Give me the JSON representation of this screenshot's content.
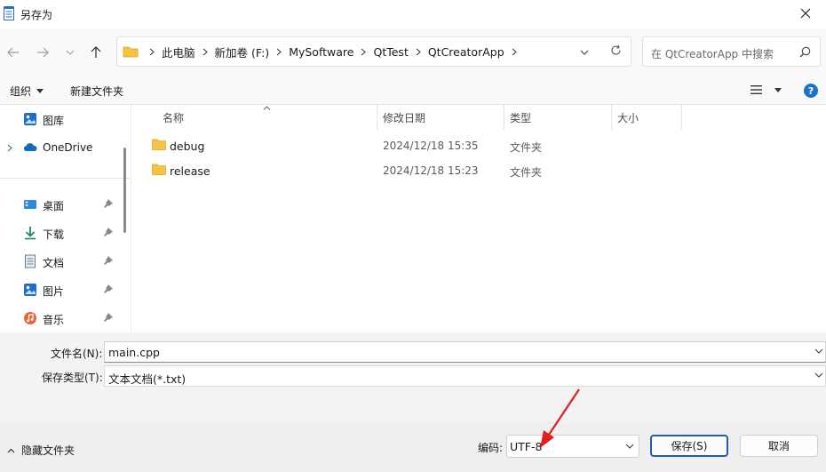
{
  "window": {
    "title": "另存为"
  },
  "breadcrumb": [
    "此电脑",
    "新加卷 (F:)",
    "MySoftware",
    "QtTest",
    "QtCreatorApp"
  ],
  "search": {
    "placeholder": "在 QtCreatorApp 中搜索"
  },
  "toolbar": {
    "organize": "组织",
    "new_folder": "新建文件夹"
  },
  "sidebar": {
    "items": [
      {
        "label": "图库",
        "icon": "gallery-icon",
        "pinned": false
      },
      {
        "label": "OneDrive",
        "icon": "onedrive-cloud-icon",
        "pinned": false
      },
      {
        "label": "桌面",
        "icon": "desktop-icon",
        "pinned": true
      },
      {
        "label": "下载",
        "icon": "download-icon",
        "pinned": true
      },
      {
        "label": "文档",
        "icon": "document-icon",
        "pinned": true
      },
      {
        "label": "图片",
        "icon": "pictures-icon",
        "pinned": true
      },
      {
        "label": "音乐",
        "icon": "music-icon",
        "pinned": true
      }
    ]
  },
  "columns": {
    "name": "名称",
    "modified": "修改日期",
    "type": "类型",
    "size": "大小"
  },
  "files": [
    {
      "name": "debug",
      "modified": "2024/12/18 15:35",
      "type": "文件夹"
    },
    {
      "name": "release",
      "modified": "2024/12/18 15:23",
      "type": "文件夹"
    }
  ],
  "form": {
    "filename_label": "文件名(N):",
    "filename": "main.cpp",
    "filetype_label": "保存类型(T):",
    "filetype": "文本文档(*.txt)"
  },
  "footer": {
    "hide_folders": "隐藏文件夹",
    "encoding_label": "编码:",
    "encoding": "UTF-8",
    "save": "保存(S)",
    "cancel": "取消"
  },
  "colors": {
    "accent": "#1f5ea8",
    "folder": "#f6c343",
    "arrow": "#e02020",
    "help": "#1a73c8"
  }
}
